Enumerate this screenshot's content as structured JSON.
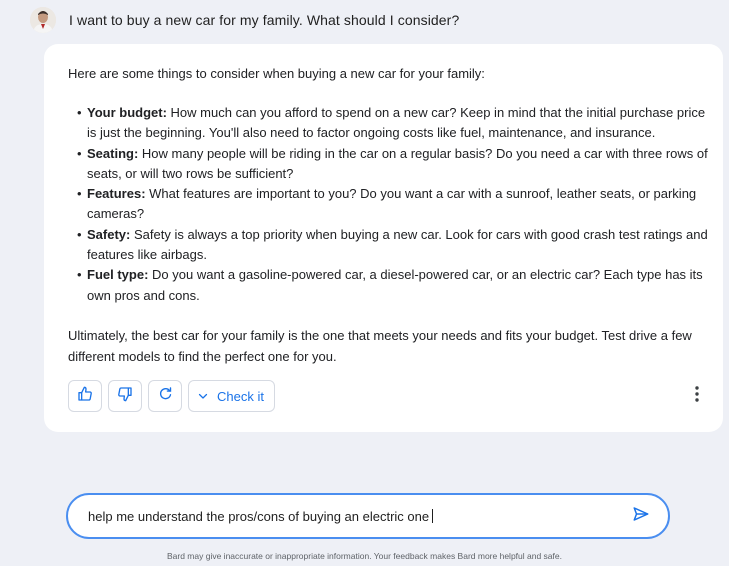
{
  "user_prompt": {
    "text": "I want to buy a new car for my family. What should I consider?"
  },
  "response": {
    "intro": "Here are some things to consider when buying a new car for your family:",
    "bullets": [
      {
        "title": "Your budget:",
        "text": "How much can you afford to spend on a new car? Keep in mind that the initial purchase price is just the beginning. You'll also need to factor ongoing costs like fuel, maintenance, and insurance."
      },
      {
        "title": "Seating:",
        "text": "How many people will be riding in the car on a regular basis? Do you need a car with three rows of seats, or will two rows be sufficient?"
      },
      {
        "title": "Features:",
        "text": "What features are important to you? Do you want a car with a sunroof, leather seats, or parking cameras?"
      },
      {
        "title": "Safety:",
        "text": "Safety is always a top priority when buying a new car. Look for cars with good crash test ratings and features like airbags."
      },
      {
        "title": "Fuel type:",
        "text": "Do you want a gasoline-powered car, a diesel-powered car, or an electric car? Each type has its own pros and cons."
      }
    ],
    "summary": "Ultimately, the best car for your family is the one that meets your needs and fits your budget. Test drive a few different models to find the perfect one for you.",
    "actions": {
      "thumbs_up_icon": "thumbs-up-icon",
      "thumbs_down_icon": "thumbs-down-icon",
      "regenerate_icon": "refresh-icon",
      "check_label": "Check it",
      "more_icon": "more-vert-icon"
    }
  },
  "composer": {
    "value": "help me understand the pros/cons of buying an electric one",
    "send_icon": "send-icon"
  },
  "disclaimer": "Bard may give inaccurate or inappropriate information. Your feedback makes Bard more helpful and safe.",
  "colors": {
    "background": "#eef0f6",
    "card": "#ffffff",
    "accent": "#1a73e8",
    "input_border": "#4a8ef0"
  }
}
